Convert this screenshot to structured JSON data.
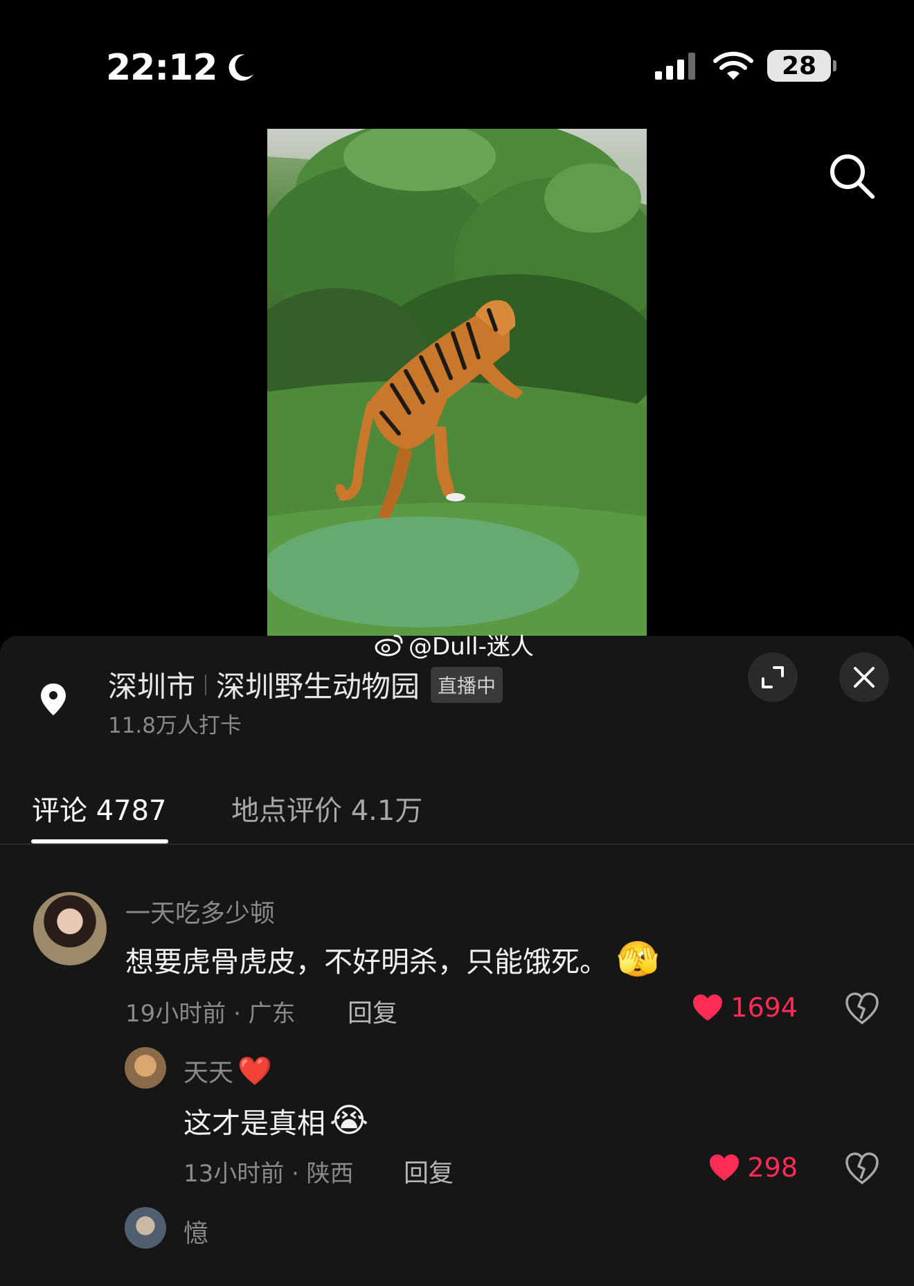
{
  "status_bar": {
    "time": "22:12",
    "battery": "28"
  },
  "watermark": {
    "text": "@Dull-迷人"
  },
  "location": {
    "city": "深圳市",
    "place": "深圳野生动物园",
    "badge": "直播中",
    "checkins": "11.8万人打卡"
  },
  "tabs": [
    {
      "label": "评论 4787",
      "active": true
    },
    {
      "label": "地点评价 4.1万",
      "active": false
    }
  ],
  "comments": [
    {
      "user": "一天吃多少顿",
      "text": "想要虎骨虎皮，不好明杀，只能饿死。",
      "emoji": "🫣",
      "meta": "19小时前 · 广东",
      "reply": "回复",
      "likes": "1694"
    },
    {
      "user": "天天",
      "user_emoji": "❤️",
      "text": "这才是真相",
      "emoji": "😭",
      "meta": "13小时前 · 陕西",
      "reply": "回复",
      "likes": "298"
    },
    {
      "user": "憶"
    }
  ],
  "colors": {
    "like": "#ff2c55",
    "sheet": "#161616"
  }
}
